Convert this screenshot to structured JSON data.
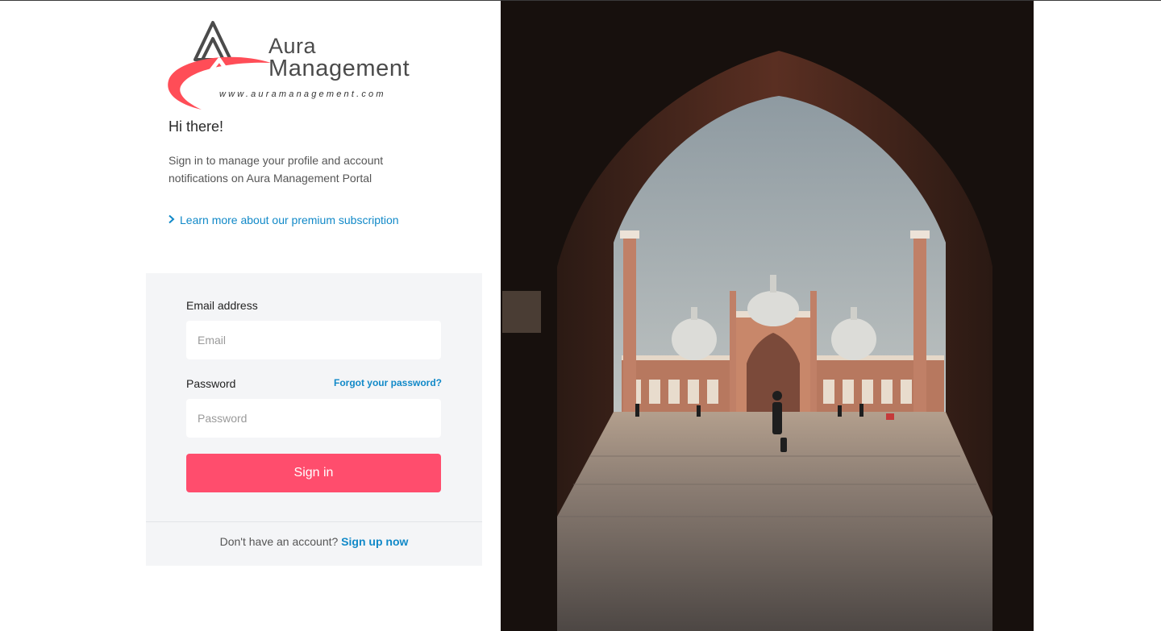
{
  "brand": {
    "line1": "Aura",
    "line2": "Management",
    "url": "www.auramanagement.com"
  },
  "intro": {
    "greeting": "Hi there!",
    "description": "Sign in to manage your profile and account notifications on Aura Management Portal",
    "premium_link": "Learn more about our premium subscription"
  },
  "form": {
    "email_label": "Email address",
    "email_placeholder": "Email",
    "password_label": "Password",
    "password_placeholder": "Password",
    "forgot_label": "Forgot your password?",
    "signin_label": "Sign in",
    "signup_prompt": "Don't have an account?",
    "signup_link": "Sign up now"
  },
  "colors": {
    "accent": "#ff4d6d",
    "link": "#1189c8",
    "card_bg": "#f4f5f7"
  }
}
